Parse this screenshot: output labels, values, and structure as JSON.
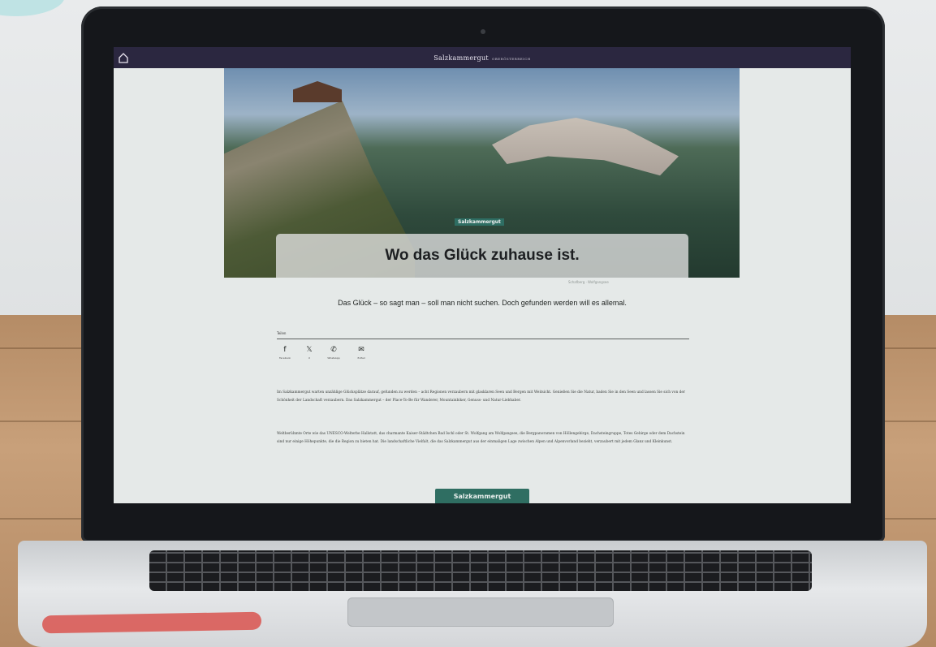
{
  "site": {
    "brand_name": "Salzkammergut",
    "brand_tagline": "OBERÖSTERREICH"
  },
  "hero": {
    "category": "Salzkammergut",
    "title": "Wo das Glück zuhause ist.",
    "credit": "Schafberg · Wolfgangsee"
  },
  "lead_text": "Das Glück – so sagt man – soll man nicht suchen. Doch gefunden werden will es allemal.",
  "share": {
    "label": "Teilen",
    "items": [
      {
        "label": "Facebook",
        "icon": "facebook-icon",
        "glyph": "f"
      },
      {
        "label": "X",
        "icon": "x-icon",
        "glyph": "𝕏"
      },
      {
        "label": "WhatsApp",
        "icon": "whatsapp-icon",
        "glyph": "✆"
      },
      {
        "label": "E-Mail",
        "icon": "email-icon",
        "glyph": "✉"
      }
    ]
  },
  "body": {
    "paragraph_1": "Im Salzkammergut warten unzählige Glücksplätze darauf, gefunden zu werden – acht Regionen verzaubern mit glasklaren Seen und Bergen mit Weitsicht. Genießen Sie die Natur, baden Sie in den Seen und lassen Sie sich von der Schönheit der Landschaft verzaubern. Das Salzkammergut – der Place-To-Be für Wanderer, Mountainbiker, Genuss- und Natur-Liebhaber.",
    "paragraph_2": "Weltberühmte Orte wie das UNESCO-Welterbe Hallstatt, das charmante Kaiser-Städtchen Bad Ischl oder St. Wolfgang am Wolfgangsee, die Bergpanoramen von Höllengebirge, Dachsteingruppe, Totes Gebirge oder dem Dachstein sind nur einige Höhepunkte, die die Region zu bieten hat. Die landschaftliche Vielfalt, die das Salzkammergut aus der einmaligen Lage zwischen Alpen und Alpenvorland bezieht, verzaubert mit jedem Glanz und Kleinkunst."
  },
  "cta_label": "Salzkammergut",
  "colors": {
    "topbar": "#2b2740",
    "accent": "#2f6e62",
    "screen_bg": "#e5e9e8"
  }
}
